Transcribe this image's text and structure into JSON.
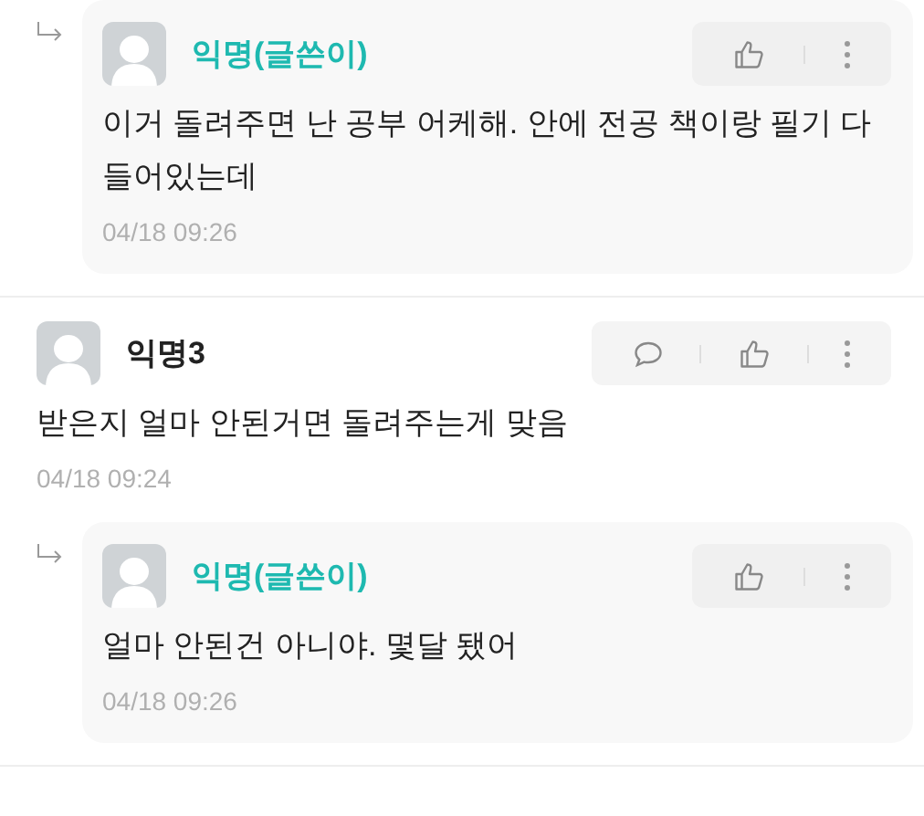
{
  "comments": [
    {
      "kind": "reply",
      "author": "익명(글쓴이)",
      "author_is_writer": true,
      "body": "이거 돌려주면 난 공부 어케해. 안에 전공 책이랑 필기 다 들어있는데",
      "time": "04/18 09:26"
    },
    {
      "kind": "comment",
      "author": "익명3",
      "author_is_writer": false,
      "body": "받은지 얼마 안된거면 돌려주는게 맞음",
      "time": "04/18 09:24"
    },
    {
      "kind": "reply",
      "author": "익명(글쓴이)",
      "author_is_writer": true,
      "body": "얼마 안된건 아니야. 몇달 됐어",
      "time": "04/18 09:26"
    }
  ]
}
